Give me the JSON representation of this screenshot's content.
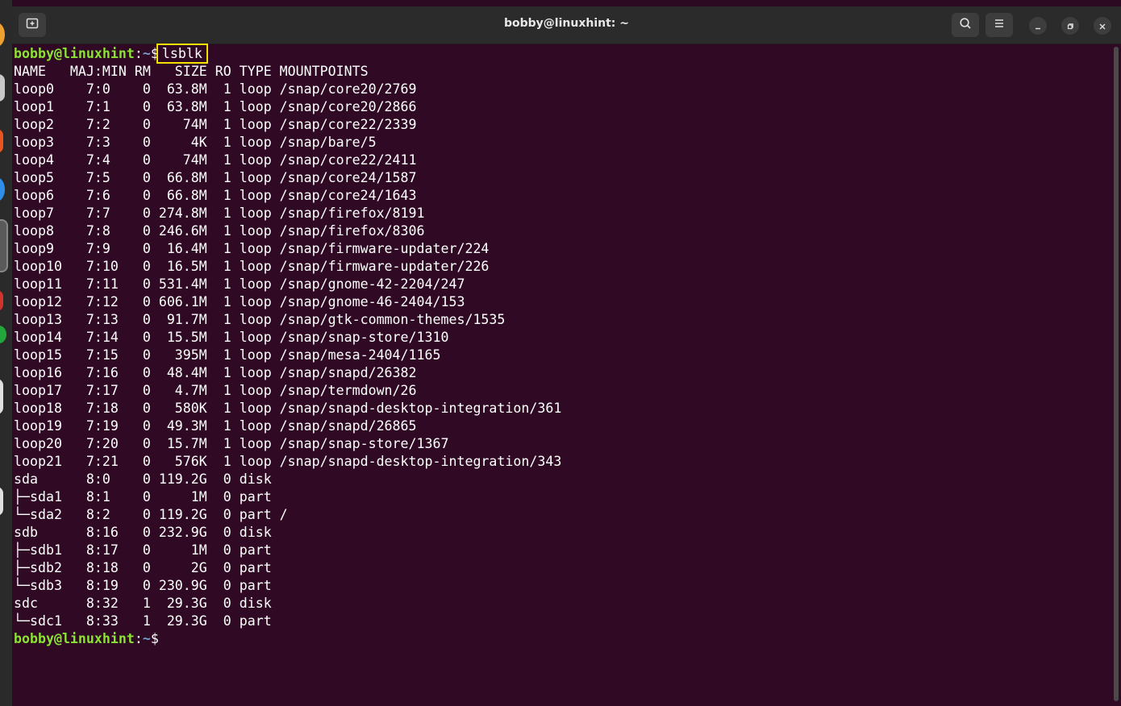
{
  "titlebar": {
    "title": "bobby@linuxhint: ~",
    "icons": [
      "new-tab-icon",
      "search-icon",
      "hamburger-menu-icon",
      "minimize-icon",
      "restore-icon",
      "close-icon"
    ]
  },
  "colors": {
    "terminal_bg": "#300a24",
    "prompt_user": "#8ae234",
    "prompt_path": "#729fcf",
    "highlight_box": "#f5e000"
  },
  "terminal": {
    "prompt_user": "bobby@linuxhint",
    "prompt_path": "~",
    "prompt_symbol": "$",
    "command": "lsblk",
    "output": [
      "NAME   MAJ:MIN RM   SIZE RO TYPE MOUNTPOINTS",
      "loop0    7:0    0  63.8M  1 loop /snap/core20/2769",
      "loop1    7:1    0  63.8M  1 loop /snap/core20/2866",
      "loop2    7:2    0    74M  1 loop /snap/core22/2339",
      "loop3    7:3    0     4K  1 loop /snap/bare/5",
      "loop4    7:4    0    74M  1 loop /snap/core22/2411",
      "loop5    7:5    0  66.8M  1 loop /snap/core24/1587",
      "loop6    7:6    0  66.8M  1 loop /snap/core24/1643",
      "loop7    7:7    0 274.8M  1 loop /snap/firefox/8191",
      "loop8    7:8    0 246.6M  1 loop /snap/firefox/8306",
      "loop9    7:9    0  16.4M  1 loop /snap/firmware-updater/224",
      "loop10   7:10   0  16.5M  1 loop /snap/firmware-updater/226",
      "loop11   7:11   0 531.4M  1 loop /snap/gnome-42-2204/247",
      "loop12   7:12   0 606.1M  1 loop /snap/gnome-46-2404/153",
      "loop13   7:13   0  91.7M  1 loop /snap/gtk-common-themes/1535",
      "loop14   7:14   0  15.5M  1 loop /snap/snap-store/1310",
      "loop15   7:15   0   395M  1 loop /snap/mesa-2404/1165",
      "loop16   7:16   0  48.4M  1 loop /snap/snapd/26382",
      "loop17   7:17   0   4.7M  1 loop /snap/termdown/26",
      "loop18   7:18   0   580K  1 loop /snap/snapd-desktop-integration/361",
      "loop19   7:19   0  49.3M  1 loop /snap/snapd/26865",
      "loop20   7:20   0  15.7M  1 loop /snap/snap-store/1367",
      "loop21   7:21   0   576K  1 loop /snap/snapd-desktop-integration/343",
      "sda      8:0    0 119.2G  0 disk",
      "├─sda1   8:1    0     1M  0 part",
      "└─sda2   8:2    0 119.2G  0 part /",
      "sdb      8:16   0 232.9G  0 disk",
      "├─sdb1   8:17   0     1M  0 part",
      "├─sdb2   8:18   0     2G  0 part",
      "└─sdb3   8:19   0 230.9G  0 part",
      "sdc      8:32   1  29.3G  0 disk",
      "└─sdc1   8:33   1  29.3G  0 part"
    ]
  }
}
